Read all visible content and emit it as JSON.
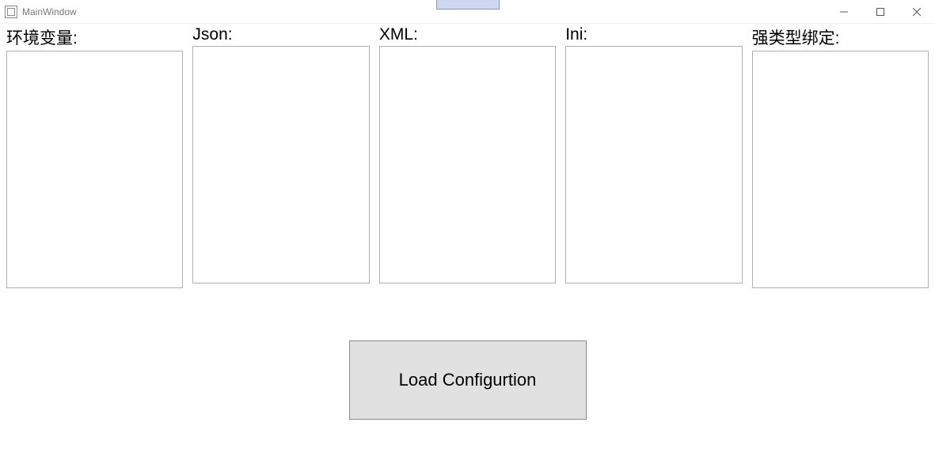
{
  "window": {
    "title": "MainWindow"
  },
  "columns": {
    "env": {
      "label": "环境变量:",
      "value": ""
    },
    "json": {
      "label": "Json:",
      "value": ""
    },
    "xml": {
      "label": "XML:",
      "value": ""
    },
    "ini": {
      "label": "Ini:",
      "value": ""
    },
    "typed": {
      "label": "强类型绑定:",
      "value": ""
    }
  },
  "button": {
    "load_label": "Load Configurtion"
  }
}
